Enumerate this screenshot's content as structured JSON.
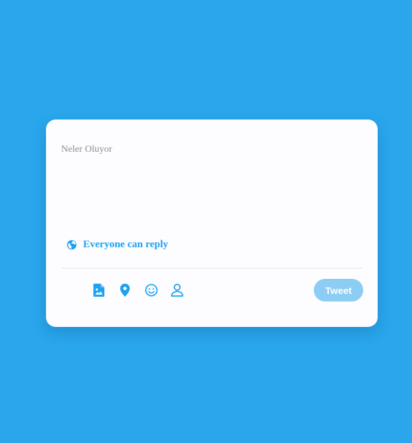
{
  "composer": {
    "placeholder": "Neler Oluyor",
    "value": ""
  },
  "reply_setting": {
    "label": "Everyone can reply",
    "icon": "globe-icon"
  },
  "toolbar": {
    "icons": [
      "image-icon",
      "location-pin-icon",
      "emoji-icon",
      "user-icon"
    ]
  },
  "tweet_button": {
    "label": "Tweet",
    "disabled": true
  },
  "colors": {
    "background": "#29a6ec",
    "card": "#fdfcff",
    "accent": "#1da1f2",
    "button_disabled": "#8ccdf4",
    "placeholder": "#8e8e8e"
  }
}
